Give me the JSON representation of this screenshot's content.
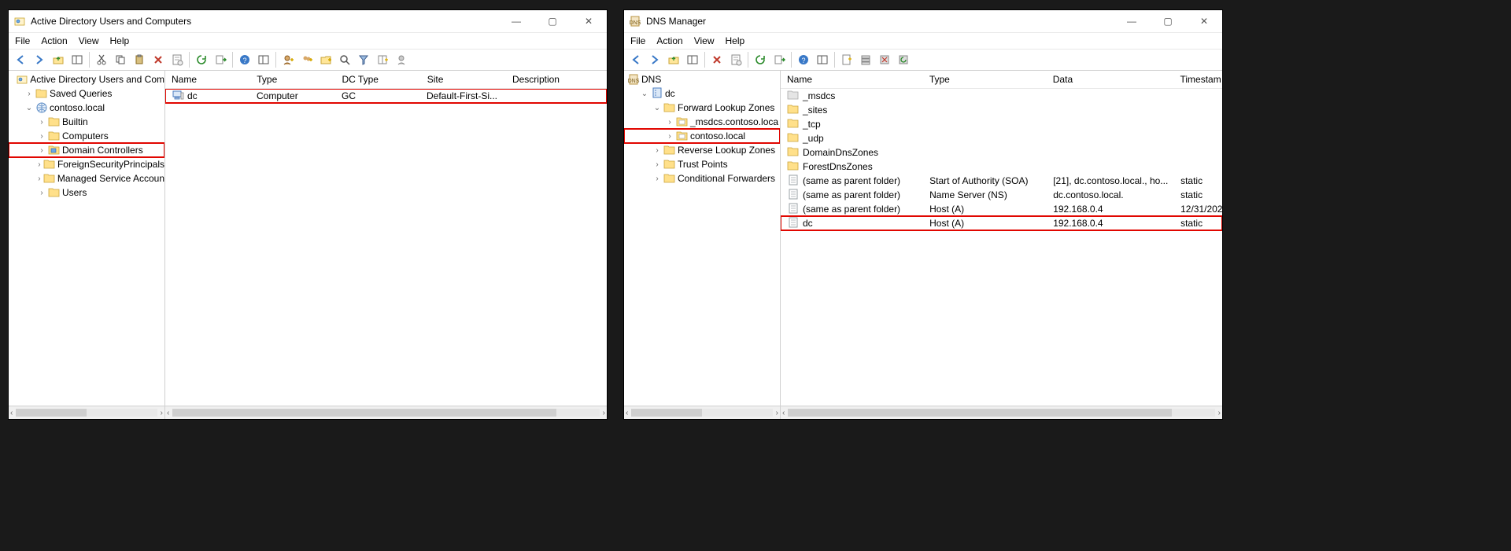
{
  "ad": {
    "title": "Active Directory Users and Computers",
    "menus": [
      "File",
      "Action",
      "View",
      "Help"
    ],
    "tree": {
      "root": "Active Directory Users and Com",
      "saved_queries": "Saved Queries",
      "domain": "contoso.local",
      "children": [
        "Builtin",
        "Computers",
        "Domain Controllers",
        "ForeignSecurityPrincipals",
        "Managed Service Accoun",
        "Users"
      ],
      "highlight_index": 2
    },
    "columns": [
      "Name",
      "Type",
      "DC Type",
      "Site",
      "Description"
    ],
    "rows": [
      {
        "name": "dc",
        "type": "Computer",
        "dctype": "GC",
        "site": "Default-First-Si...",
        "desc": "",
        "highlight": true,
        "icon": "computer"
      }
    ]
  },
  "dns": {
    "title": "DNS Manager",
    "menus": [
      "File",
      "Action",
      "View",
      "Help"
    ],
    "tree": {
      "root": "DNS",
      "server": "dc",
      "fwd": "Forward Lookup Zones",
      "msdcs": "_msdcs.contoso.loca",
      "zone": "contoso.local",
      "rev": "Reverse Lookup Zones",
      "trust": "Trust Points",
      "cond": "Conditional Forwarders"
    },
    "columns": [
      "Name",
      "Type",
      "Data",
      "Timestam"
    ],
    "rows": [
      {
        "name": "_msdcs",
        "type": "",
        "data": "",
        "ts": "",
        "icon": "greyfolder"
      },
      {
        "name": "_sites",
        "type": "",
        "data": "",
        "ts": "",
        "icon": "folder"
      },
      {
        "name": "_tcp",
        "type": "",
        "data": "",
        "ts": "",
        "icon": "folder"
      },
      {
        "name": "_udp",
        "type": "",
        "data": "",
        "ts": "",
        "icon": "folder"
      },
      {
        "name": "DomainDnsZones",
        "type": "",
        "data": "",
        "ts": "",
        "icon": "folder"
      },
      {
        "name": "ForestDnsZones",
        "type": "",
        "data": "",
        "ts": "",
        "icon": "folder"
      },
      {
        "name": "(same as parent folder)",
        "type": "Start of Authority (SOA)",
        "data": "[21], dc.contoso.local., ho...",
        "ts": "static",
        "icon": "page"
      },
      {
        "name": "(same as parent folder)",
        "type": "Name Server (NS)",
        "data": "dc.contoso.local.",
        "ts": "static",
        "icon": "page"
      },
      {
        "name": "(same as parent folder)",
        "type": "Host (A)",
        "data": "192.168.0.4",
        "ts": "12/31/202",
        "icon": "page"
      },
      {
        "name": "dc",
        "type": "Host (A)",
        "data": "192.168.0.4",
        "ts": "static",
        "icon": "page",
        "highlight": true
      }
    ]
  }
}
